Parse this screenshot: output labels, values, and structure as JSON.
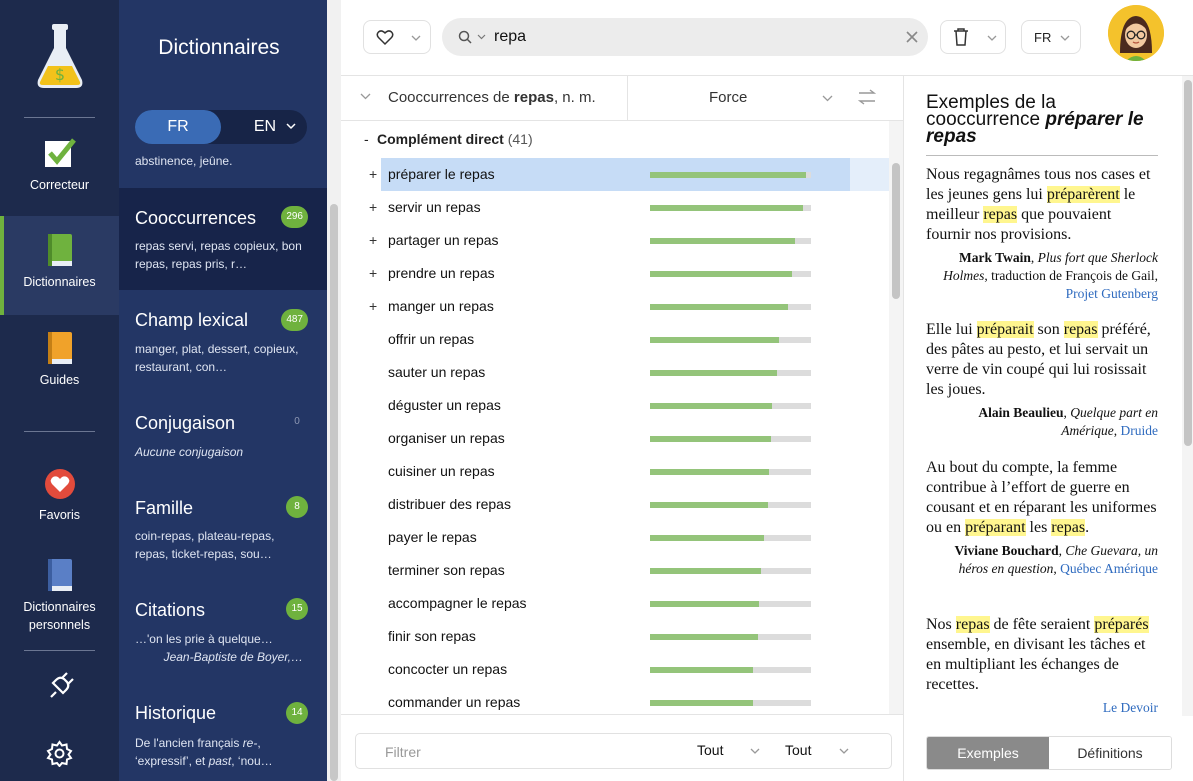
{
  "rail": {
    "items": [
      {
        "label": "Correcteur"
      },
      {
        "label": "Dictionnaires"
      },
      {
        "label": "Guides"
      },
      {
        "label": "Favoris"
      },
      {
        "label_line1": "Dictionnaires",
        "label_line2": "personnels"
      }
    ]
  },
  "sections": {
    "title": "Dictionnaires",
    "lang_fr": "FR",
    "lang_en": "EN",
    "top_text": "abstinence, jeûne.",
    "items": [
      {
        "name": "Cooccurrences",
        "count": "296",
        "desc": "repas servi, repas copieux, bon repas, repas pris, r…"
      },
      {
        "name": "Champ lexical",
        "count": "487",
        "desc": "manger, plat, dessert, copieux, restaurant, con…"
      },
      {
        "name": "Conjugaison",
        "count": "0",
        "desc": "Aucune conjugaison"
      },
      {
        "name": "Famille",
        "count": "8",
        "desc": "coin-repas, plateau-repas, repas, ticket-repas, sou…"
      },
      {
        "name": "Citations",
        "count": "15",
        "desc": "…'on les prie à quelque…",
        "desc2": "Jean-Baptiste de Boyer,…"
      },
      {
        "name": "Historique",
        "count": "14",
        "desc_pre": "De l'ancien français ",
        "desc_it": "re-",
        "desc_post": ", ‘expressif’, et ",
        "desc_it2": "past",
        "desc_post2": ", ‘nou…"
      }
    ]
  },
  "topbar": {
    "search_value": "repa",
    "lang": "FR"
  },
  "list": {
    "header_prefix": "Cooccurrences de ",
    "header_word": "repas",
    "header_suffix": ", n. m.",
    "header_col2": "Force",
    "group_label": "Complément direct",
    "group_count": "(41)",
    "rows": [
      {
        "term": "préparer le repas",
        "expand": "+",
        "strength": 0.97,
        "selected": true
      },
      {
        "term": "servir un repas",
        "expand": "+",
        "strength": 0.95
      },
      {
        "term": "partager un repas",
        "expand": "+",
        "strength": 0.9
      },
      {
        "term": "prendre un repas",
        "expand": "+",
        "strength": 0.88
      },
      {
        "term": "manger un repas",
        "expand": "+",
        "strength": 0.86
      },
      {
        "term": "offrir un repas",
        "expand": "",
        "strength": 0.8
      },
      {
        "term": "sauter un repas",
        "expand": "",
        "strength": 0.79
      },
      {
        "term": "déguster un repas",
        "expand": "",
        "strength": 0.76
      },
      {
        "term": "organiser un repas",
        "expand": "",
        "strength": 0.75
      },
      {
        "term": "cuisiner un repas",
        "expand": "",
        "strength": 0.74
      },
      {
        "term": "distribuer des repas",
        "expand": "",
        "strength": 0.73
      },
      {
        "term": "payer le repas",
        "expand": "",
        "strength": 0.71
      },
      {
        "term": "terminer son repas",
        "expand": "",
        "strength": 0.69
      },
      {
        "term": "accompagner le repas",
        "expand": "",
        "strength": 0.68
      },
      {
        "term": "finir son repas",
        "expand": "",
        "strength": 0.67
      },
      {
        "term": "concocter un repas",
        "expand": "",
        "strength": 0.64
      },
      {
        "term": "commander un repas",
        "expand": "",
        "strength": 0.64
      }
    ],
    "filter_placeholder": "Filtrer",
    "filter_sel1": "Tout",
    "filter_sel2": "Tout"
  },
  "examples": {
    "title_pre": "Exemples de la cooccurrence ",
    "title_term": "préparer le repas",
    "tab_examples": "Exemples",
    "tab_definitions": "Définitions",
    "items": [
      {
        "parts": [
          [
            "Nous regagnâmes tous nos cases et les jeunes gens lui ",
            false
          ],
          [
            "préparèrent",
            true
          ],
          [
            " le meilleur ",
            false
          ],
          [
            "repas",
            true
          ],
          [
            " que pouvaient fournir nos provisions.",
            false
          ]
        ],
        "author": "Mark Twain",
        "book": "Plus fort que Sherlock Holmes",
        "extra": ", traduction de François de Gail, ",
        "publisher": "Projet Gutenberg"
      },
      {
        "parts": [
          [
            "Elle lui ",
            false
          ],
          [
            "préparait",
            true
          ],
          [
            " son ",
            false
          ],
          [
            "repas",
            true
          ],
          [
            " préféré, des pâtes au pesto, et lui servait un verre de vin coupé qui lui rosissait les joues.",
            false
          ]
        ],
        "author": "Alain Beaulieu",
        "book": "Quelque part en Amérique",
        "extra": ", ",
        "publisher": "Druide"
      },
      {
        "parts": [
          [
            "Au bout du compte, la femme contribue à l’effort de guerre en cousant et en réparant les uniformes ou en ",
            false
          ],
          [
            "préparant",
            true
          ],
          [
            " les ",
            false
          ],
          [
            "repas",
            true
          ],
          [
            ".",
            false
          ]
        ],
        "author": "Viviane Bouchard",
        "book": "Che Guevara, un héros en question",
        "extra": ", ",
        "publisher": "Québec Amérique"
      },
      {
        "parts": [
          [
            "Nos ",
            false
          ],
          [
            "repas",
            true
          ],
          [
            " de fête seraient ",
            false
          ],
          [
            "préparés",
            true
          ],
          [
            " ensemble, en divisant les tâches et en multipliant les échanges de recettes.",
            false
          ]
        ],
        "author": "",
        "book": "",
        "extra": "",
        "publisher": "Le Devoir"
      }
    ]
  },
  "colors": {
    "rail": "#1d2a4c",
    "sections": "#233665",
    "accent_green": "#6fb23e",
    "selection": "#c6dcf6",
    "highlight": "#fff68f",
    "link": "#2f6bbf"
  }
}
